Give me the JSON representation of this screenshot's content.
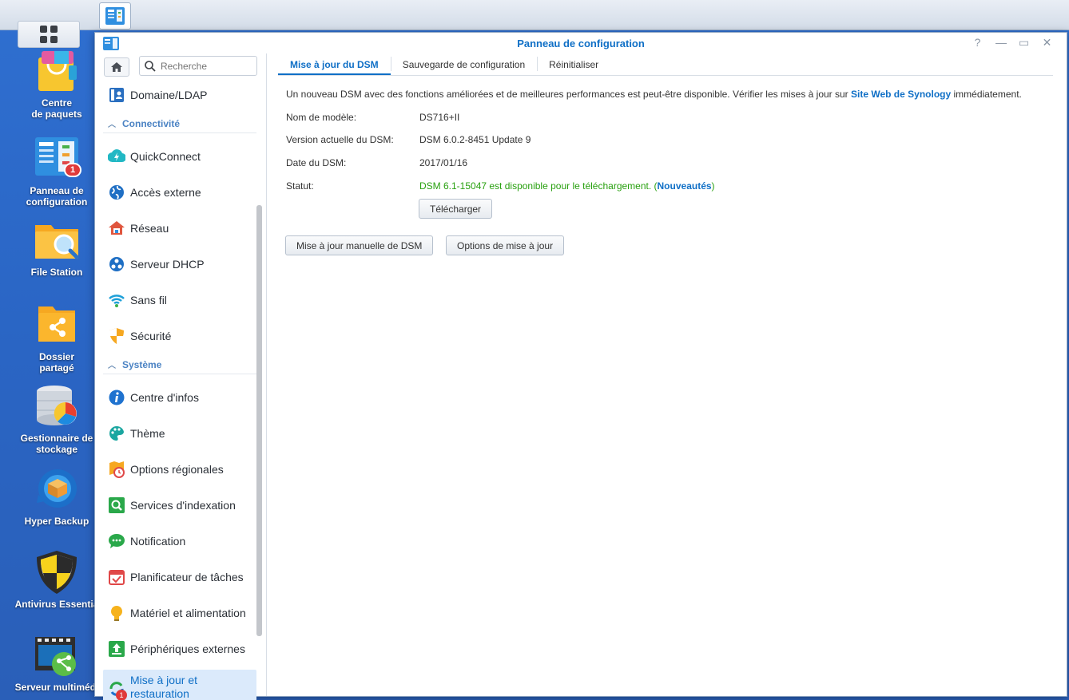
{
  "taskbar": {
    "main_menu_icon": "main-menu-grid-icon",
    "open_app_icon": "control-panel-icon"
  },
  "desktop": {
    "icons": [
      {
        "label": "Centre\nde paquets",
        "icon": "package-center-icon"
      },
      {
        "label": "Panneau de\nconfiguration",
        "icon": "control-panel-icon",
        "badge": "1"
      },
      {
        "label": "File Station",
        "icon": "file-station-icon"
      },
      {
        "label": "Dossier\npartagé",
        "icon": "shared-folder-icon"
      },
      {
        "label": "Gestionnaire de\nstockage",
        "icon": "storage-manager-icon"
      },
      {
        "label": "Hyper Backup",
        "icon": "hyper-backup-icon"
      },
      {
        "label": "Antivirus Essentia",
        "icon": "antivirus-icon"
      },
      {
        "label": "Serveur multimédi",
        "icon": "media-server-icon"
      }
    ]
  },
  "window": {
    "title": "Panneau de configuration",
    "controls": [
      "?",
      "—",
      "▭",
      "✕"
    ]
  },
  "sidebar": {
    "search_placeholder": "Recherche",
    "top_item": "Domaine/LDAP",
    "section_connectivity": "Connectivité",
    "connectivity_items": [
      "QuickConnect",
      "Accès externe",
      "Réseau",
      "Serveur DHCP",
      "Sans fil",
      "Sécurité"
    ],
    "section_system": "Système",
    "system_items": [
      "Centre d'infos",
      "Thème",
      "Options régionales",
      "Services d'indexation",
      "Notification",
      "Planificateur de tâches",
      "Matériel et alimentation",
      "Périphériques externes"
    ],
    "active_item": "Mise à jour et\nrestauration",
    "active_badge": "1"
  },
  "main": {
    "tabs": [
      "Mise à jour du DSM",
      "Sauvegarde de configuration",
      "Réinitialiser"
    ],
    "notice_prefix": "Un nouveau DSM avec des fonctions améliorées et de meilleures performances est peut-être disponible. Vérifier les mises à jour sur ",
    "notice_link": "Site Web de Synology",
    "notice_suffix": " immédiatement.",
    "rows": [
      {
        "key": "Nom de modèle:",
        "value": "DS716+II"
      },
      {
        "key": "Version actuelle du DSM:",
        "value": "DSM 6.0.2-8451 Update 9"
      },
      {
        "key": "Date du DSM:",
        "value": "2017/01/16"
      }
    ],
    "status_key": "Statut:",
    "status_text": "DSM 6.1-15047 est disponible pour le téléchargement. (",
    "status_link": "Nouveautés",
    "status_close": ")",
    "download_button": "Télécharger",
    "manual_update_button": "Mise à jour manuelle de DSM",
    "update_options_button": "Options de mise à jour"
  }
}
